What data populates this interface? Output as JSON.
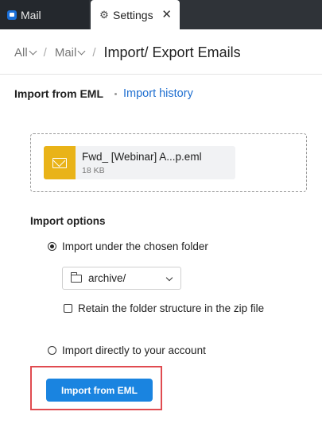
{
  "tabs": [
    {
      "label": "Mail",
      "icon": "mail-icon"
    },
    {
      "label": "Settings",
      "icon": "gear-icon",
      "close": "✕"
    }
  ],
  "breadcrumb": {
    "all": "All",
    "mail": "Mail",
    "separator": "/",
    "title": "Import/ Export Emails"
  },
  "subtabs": {
    "active": "Import from EML",
    "history": "Import history"
  },
  "file": {
    "name": "Fwd_ [Webinar] A...p.eml",
    "size": "18 KB",
    "icon": "envelope-icon",
    "icon_color": "#e9b318"
  },
  "options": {
    "heading": "Import options",
    "chosen_folder_label": "Import under the chosen folder",
    "chosen_folder_selected": true,
    "folder_value": "archive/",
    "retain_label": "Retain the folder structure in the zip file",
    "retain_checked": false,
    "direct_label": "Import directly to your account",
    "direct_selected": false
  },
  "action": {
    "import_label": "Import from EML",
    "accent": "#1a84e0",
    "highlight_color": "#e04b50"
  }
}
